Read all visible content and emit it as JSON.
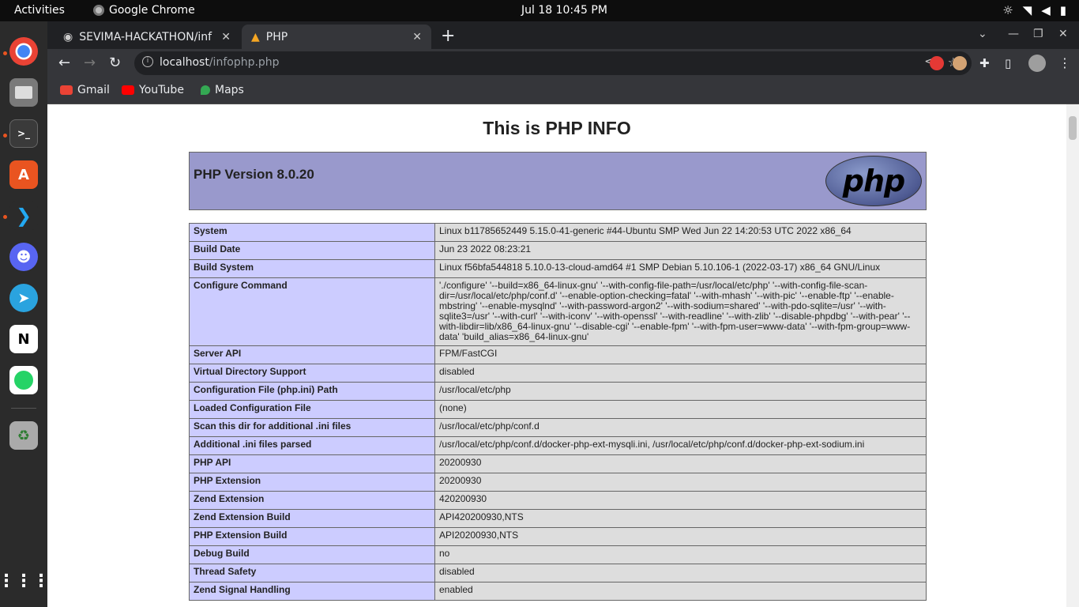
{
  "topbar": {
    "activities": "Activities",
    "app_name": "Google Chrome",
    "clock": "Jul 18  10:45 PM",
    "tray_icons": [
      "brightness-icon",
      "wifi-icon",
      "volume-icon",
      "battery-icon"
    ]
  },
  "dock": {
    "apps": [
      "chrome-icon",
      "files-icon",
      "terminal-icon",
      "app-store-icon",
      "vscode-icon",
      "discord-icon",
      "telegram-icon",
      "notion-icon",
      "whatsapp-icon",
      "trash-icon",
      "app-grid-icon"
    ]
  },
  "tabs": [
    {
      "title": "SEVIMA-HACKATHON/inf",
      "icon": "github-icon",
      "active": false
    },
    {
      "title": "PHP",
      "icon": "php-favicon",
      "active": true
    }
  ],
  "toolbar": {
    "url_host": "localhost",
    "url_path": "/infophp.php"
  },
  "bookmarks": [
    {
      "label": "Gmail",
      "icon": "gmail-icon",
      "color": "#ea4335"
    },
    {
      "label": "YouTube",
      "icon": "youtube-icon",
      "color": "#ff0000"
    },
    {
      "label": "Maps",
      "icon": "maps-icon",
      "color": "#34a853"
    }
  ],
  "page": {
    "heading": "This is PHP INFO",
    "version": "PHP Version 8.0.20",
    "logo_text": "php",
    "rows": [
      {
        "key": "System",
        "value": "Linux b11785652449 5.15.0-41-generic #44-Ubuntu SMP Wed Jun 22 14:20:53 UTC 2022 x86_64"
      },
      {
        "key": "Build Date",
        "value": "Jun 23 2022 08:23:21"
      },
      {
        "key": "Build System",
        "value": "Linux f56bfa544818 5.10.0-13-cloud-amd64 #1 SMP Debian 5.10.106-1 (2022-03-17) x86_64 GNU/Linux"
      },
      {
        "key": "Configure Command",
        "value": "'./configure' '--build=x86_64-linux-gnu' '--with-config-file-path=/usr/local/etc/php' '--with-config-file-scan-dir=/usr/local/etc/php/conf.d' '--enable-option-checking=fatal' '--with-mhash' '--with-pic' '--enable-ftp' '--enable-mbstring' '--enable-mysqlnd' '--with-password-argon2' '--with-sodium=shared' '--with-pdo-sqlite=/usr' '--with-sqlite3=/usr' '--with-curl' '--with-iconv' '--with-openssl' '--with-readline' '--with-zlib' '--disable-phpdbg' '--with-pear' '--with-libdir=lib/x86_64-linux-gnu' '--disable-cgi' '--enable-fpm' '--with-fpm-user=www-data' '--with-fpm-group=www-data' 'build_alias=x86_64-linux-gnu'"
      },
      {
        "key": "Server API",
        "value": "FPM/FastCGI"
      },
      {
        "key": "Virtual Directory Support",
        "value": "disabled"
      },
      {
        "key": "Configuration File (php.ini) Path",
        "value": "/usr/local/etc/php"
      },
      {
        "key": "Loaded Configuration File",
        "value": "(none)"
      },
      {
        "key": "Scan this dir for additional .ini files",
        "value": "/usr/local/etc/php/conf.d"
      },
      {
        "key": "Additional .ini files parsed",
        "value": "/usr/local/etc/php/conf.d/docker-php-ext-mysqli.ini, /usr/local/etc/php/conf.d/docker-php-ext-sodium.ini"
      },
      {
        "key": "PHP API",
        "value": "20200930"
      },
      {
        "key": "PHP Extension",
        "value": "20200930"
      },
      {
        "key": "Zend Extension",
        "value": "420200930"
      },
      {
        "key": "Zend Extension Build",
        "value": "API420200930,NTS"
      },
      {
        "key": "PHP Extension Build",
        "value": "API20200930,NTS"
      },
      {
        "key": "Debug Build",
        "value": "no"
      },
      {
        "key": "Thread Safety",
        "value": "disabled"
      },
      {
        "key": "Zend Signal Handling",
        "value": "enabled"
      }
    ]
  },
  "colors": {
    "header_bg": "#9999cc",
    "key_cell_bg": "#ccccff",
    "value_cell_bg": "#dddddd",
    "ubuntu_accent": "#e95420"
  }
}
